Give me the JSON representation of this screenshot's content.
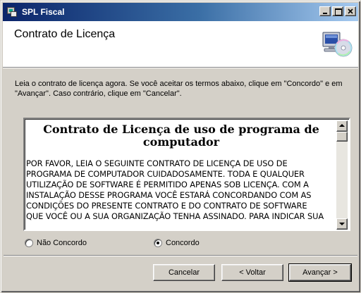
{
  "window": {
    "title": "SPL Fiscal"
  },
  "header": {
    "title": "Contrato de Licença"
  },
  "instructions": "Leia o contrato de licença agora. Se você aceitar os termos abaixo, clique em \"Concordo\" e em \"Avançar\". Caso contrário, clique em \"Cancelar\".",
  "license": {
    "heading": "Contrato de Licença de uso de programa de computador",
    "lines": [
      "POR FAVOR, LEIA O SEGUINTE CONTRATO DE LICENÇA DE USO DE",
      "PROGRAMA DE COMPUTADOR CUIDADOSAMENTE. TODA E QUALQUER",
      "UTILIZAÇÃO DE SOFTWARE É PERMITIDO APENAS SOB LICENÇA. COM A",
      "INSTALAÇÃO DESSE PROGRAMA VOCÊ ESTARÁ CONCORDANDO COM AS",
      "CONDIÇÕES DO PRESENTE CONTRATO E DO  CONTRATO DE SOFTWARE",
      "QUE VOCÊ OU A SUA ORGANIZAÇÃO TENHA ASSINADO. PARA INDICAR SUA"
    ]
  },
  "options": {
    "disagree": {
      "label": "Não Concordo",
      "checked": false
    },
    "agree": {
      "label": "Concordo",
      "checked": true
    }
  },
  "buttons": {
    "cancel": "Cancelar",
    "back": "< Voltar",
    "next": "Avançar >"
  },
  "icons": {
    "app": "setup-app-icon",
    "header": "computer-cd-icon"
  },
  "colors": {
    "titlebar_start": "#0a246a",
    "titlebar_end": "#a6caf0",
    "face": "#d4d0c8"
  }
}
